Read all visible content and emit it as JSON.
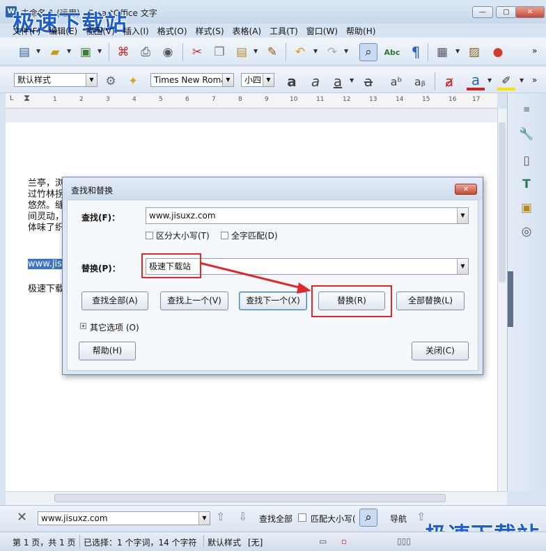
{
  "window": {
    "title": "未命名 1 (运用) - SmartOffice 文字",
    "watermark": "极速下载站",
    "min": "—",
    "max": "▢",
    "close": "✕"
  },
  "menu": [
    "文件(F)",
    "编辑(E)",
    "视图(V)",
    "插入(I)",
    "格式(O)",
    "样式(S)",
    "表格(A)",
    "工具(T)",
    "窗口(W)",
    "帮助(H)"
  ],
  "toolbar2": {
    "style": "默认样式",
    "font": "Times New Roman",
    "size": "小四"
  },
  "ruler": [
    "1",
    "2",
    "3",
    "4",
    "5",
    "6",
    "7",
    "8",
    "9",
    "10",
    "11",
    "12",
    "13",
    "14",
    "15",
    "16",
    "17"
  ],
  "doc": {
    "lines": [
      "兰亭，浏",
      "过竹林拐",
      "悠然。缝",
      "间灵动，",
      "体味了织"
    ],
    "selected": "www.jis",
    "line2": "极速下载"
  },
  "dialog": {
    "title": "查找和替换",
    "find_label": "查找(F)：",
    "find_value": "www.jisuxz.com",
    "match_case": "区分大小写(T)",
    "whole_word": "全字匹配(D)",
    "replace_label": "替换(P)：",
    "replace_value": "极速下载站",
    "buttons": {
      "find_all": "查找全部(A)",
      "find_prev": "查找上一个(V)",
      "find_next": "查找下一个(X)",
      "replace": "替换(R)",
      "replace_all": "全部替换(L)",
      "help": "帮助(H)",
      "close": "关闭(C)"
    },
    "more": "其它选项 (O)"
  },
  "findbar": {
    "value": "www.jisuxz.com",
    "find_all": "查找全部",
    "match_case": "匹配大小写(",
    "nav": "导航"
  },
  "status": {
    "page": "第 1 页，共 1 页",
    "selection": "已选择：1 个字词，14 个字符",
    "style": "默认样式",
    "mode": "[无]"
  },
  "colors": {
    "highlight": "#e3262a",
    "selection": "#3a74cf",
    "accent": "#2a64b6"
  }
}
